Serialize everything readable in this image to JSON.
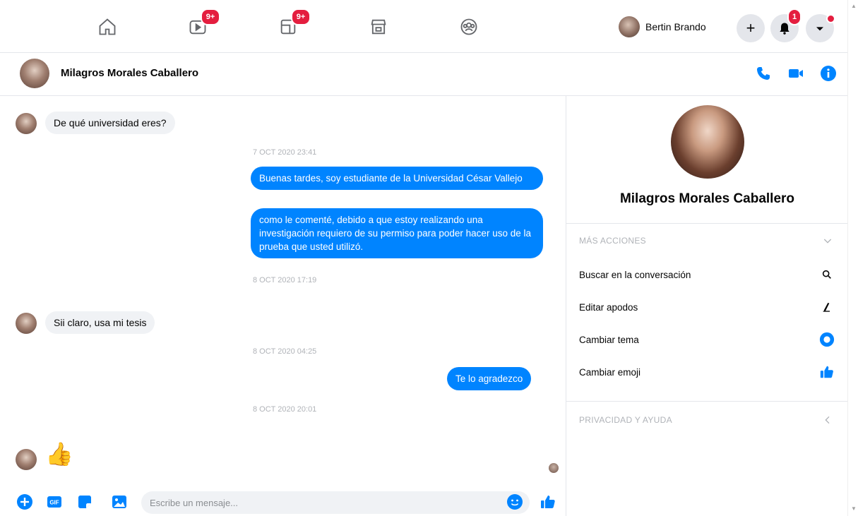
{
  "topbar": {
    "nav": [
      {
        "icon": "home-icon"
      },
      {
        "icon": "watch-icon",
        "badge": "9+"
      },
      {
        "icon": "pages-icon",
        "badge": "9+"
      },
      {
        "icon": "marketplace-icon"
      },
      {
        "icon": "groups-icon"
      }
    ],
    "user_name": "Bertin Brando",
    "create_label": "+",
    "notifications_badge": "1"
  },
  "conversation": {
    "contact_name": "Milagros Morales Caballero",
    "actions": [
      "phone-icon",
      "video-call-icon",
      "info-icon"
    ]
  },
  "messages": {
    "m1": "De qué universidad eres?",
    "t1": "7 OCT 2020 23:41",
    "m2": "Buenas tardes, soy estudiante de la Universidad César Vallejo",
    "m3": "como le comenté, debido a que estoy realizando una investigación requiero de su permiso para poder hacer uso de la prueba que usted utilizó.",
    "t2": "8 OCT 2020 17:19",
    "m4": "Sii claro, usa mi tesis",
    "t3": "8 OCT 2020 04:25",
    "m5": "Te lo agradezco",
    "t4": "8 OCT 2020 20:01",
    "m6": "👍"
  },
  "composer": {
    "placeholder": "Escribe un mensaje..."
  },
  "info_panel": {
    "name": "Milagros Morales Caballero",
    "section_more": "MÁS ACCIONES",
    "actions": [
      {
        "label": "Buscar en la conversación",
        "icon": "search-icon"
      },
      {
        "label": "Editar apodos",
        "icon": "pencil-icon"
      },
      {
        "label": "Cambiar tema",
        "icon": "theme-icon"
      },
      {
        "label": "Cambiar emoji",
        "icon": "thumbs-up-icon"
      }
    ],
    "section_privacy": "PRIVACIDAD Y AYUDA"
  },
  "colors": {
    "accent": "#0084ff",
    "badge": "#e41e3f",
    "incoming_bubble": "#f0f2f5"
  }
}
